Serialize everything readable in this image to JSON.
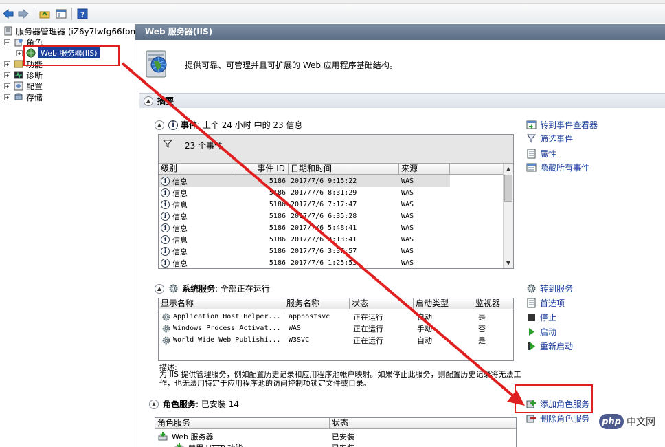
{
  "toolbar": {
    "buttons": [
      "back-icon",
      "forward-icon",
      "up-folder-icon",
      "show-hide-console-icon",
      "help-icon"
    ]
  },
  "tree": {
    "root": "服务器管理器 (iZ6y7lwfg66fbn",
    "roles": "角色",
    "web_server": "Web 服务器(IIS)",
    "features": "功能",
    "diagnostics": "诊断",
    "configuration": "配置",
    "storage": "存储"
  },
  "content": {
    "header": "Web 服务器(IIS)",
    "intro": "提供可靠、可管理并且可扩展的 Web 应用程序基础结构。",
    "summary_title": "摘要",
    "events": {
      "heading_bold": "事件",
      "heading_rest": ": 上个 24 小时 中的 23 信息",
      "filter_text": "23 个事件",
      "columns": [
        "级别",
        "事件 ID",
        "日期和时间",
        "来源"
      ],
      "rows": [
        {
          "level": "信息",
          "id": "5186",
          "datetime": "2017/7/6 9:15:22",
          "source": "WAS"
        },
        {
          "level": "信息",
          "id": "5186",
          "datetime": "2017/7/6 8:31:29",
          "source": "WAS"
        },
        {
          "level": "信息",
          "id": "5186",
          "datetime": "2017/7/6 7:17:47",
          "source": "WAS"
        },
        {
          "level": "信息",
          "id": "5186",
          "datetime": "2017/7/6 6:35:28",
          "source": "WAS"
        },
        {
          "level": "信息",
          "id": "5186",
          "datetime": "2017/7/6 5:48:41",
          "source": "WAS"
        },
        {
          "level": "信息",
          "id": "5186",
          "datetime": "2017/7/6 2:13:41",
          "source": "WAS"
        },
        {
          "level": "信息",
          "id": "5186",
          "datetime": "2017/7/6 3:37:57",
          "source": "WAS"
        },
        {
          "level": "信息",
          "id": "5186",
          "datetime": "2017/7/6 1:25:53",
          "source": "WAS"
        }
      ],
      "actions": [
        "转到事件查看器",
        "筛选事件",
        "属性",
        "隐藏所有事件"
      ]
    },
    "services": {
      "heading_bold": "系统服务",
      "heading_rest": ": 全部正在运行",
      "columns": [
        "显示名称",
        "服务名称",
        "状态",
        "启动类型",
        "监视器"
      ],
      "rows": [
        {
          "display": "Application Host Helper...",
          "name": "apphostsvc",
          "status": "正在运行",
          "startup": "自动",
          "monitor": "是"
        },
        {
          "display": "Windows Process Activat...",
          "name": "WAS",
          "status": "正在运行",
          "startup": "手动",
          "monitor": "否"
        },
        {
          "display": "World Wide Web Publishi...",
          "name": "W3SVC",
          "status": "正在运行",
          "startup": "自动",
          "monitor": "是"
        }
      ],
      "description_label": "描述:",
      "description": "为 IIS 提供管理服务，例如配置历史记录和应用程序池帐户映射。如果停止此服务，则配置历史记录将无法工作，也无法用特定于应用程序池的访问控制项锁定文件或目录。",
      "actions": [
        "转到服务",
        "首选项",
        "停止",
        "启动",
        "重新启动"
      ]
    },
    "role_services": {
      "heading_bold": "角色服务",
      "heading_rest": ": 已安装 14",
      "columns": [
        "角色服务",
        "状态"
      ],
      "rows": [
        {
          "name": "Web 服务器",
          "status": "已安装"
        },
        {
          "name": "常用 HTTP 功能",
          "status": "已安装"
        }
      ],
      "actions": [
        "添加角色服务",
        "删除角色服务"
      ]
    }
  },
  "watermark": {
    "brand": "php",
    "site": "中文网"
  },
  "colors": {
    "annotation_red": "#e02020",
    "selection_blue": "#1c3f9b",
    "link_blue": "#1a3c9c"
  }
}
